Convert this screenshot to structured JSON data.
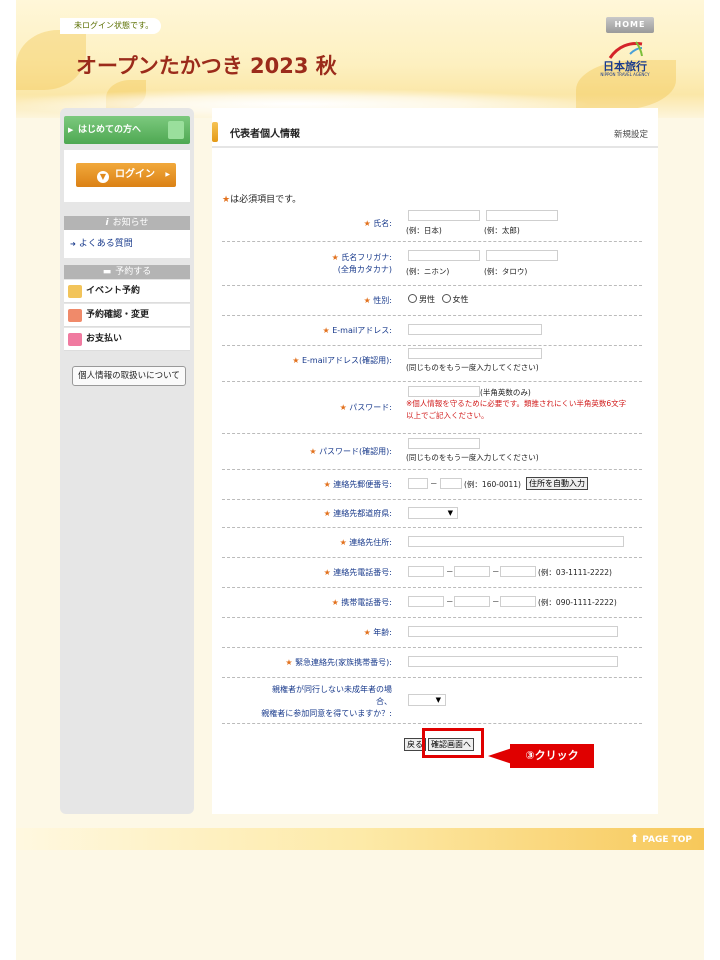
{
  "header": {
    "status": "未ログイン状態です。",
    "title": "オープンたかつき 2023 秋",
    "home_label": "HOME",
    "logo_jp": "日本旅行",
    "logo_en": "NIPPON TRAVEL AGENCY"
  },
  "sidebar": {
    "hajimete": "はじめての方へ",
    "login": "ログイン",
    "news_head": "お知らせ",
    "faq": "よくある質問",
    "reserve_head": "予約する",
    "items": [
      "イベント予約",
      "予約確認・変更",
      "お支払い"
    ],
    "privacy_btn": "個人情報の取扱いについて"
  },
  "main": {
    "title": "代表者個人情報",
    "subtitle": "新規設定",
    "required_note": "は必須項目です。",
    "fields": {
      "name_label": "氏名:",
      "name_hint1": "(例：日本)",
      "name_hint2": "(例：太郎)",
      "kana_label1": "氏名フリガナ:",
      "kana_label2": "(全角カタカナ)",
      "kana_hint1": "(例：ニホン)",
      "kana_hint2": "(例：タロウ)",
      "gender_label": "性別:",
      "gender_male": "男性",
      "gender_female": "女性",
      "email_label": "E-mailアドレス:",
      "email_confirm_label": "E-mailアドレス(確認用):",
      "email_confirm_hint": "(同じものをもう一度入力してください)",
      "password_label": "パスワード:",
      "password_hint": "(半角英数のみ)",
      "password_warn1": "※個人情報を守るために必要です。類推されにくい半角英数6文字",
      "password_warn2": "以上でご記入ください。",
      "password_confirm_label": "パスワード(確認用):",
      "password_confirm_hint": "(同じものをもう一度入力してください)",
      "zip_label": "連絡先郵便番号:",
      "zip_sep": "－",
      "zip_hint": "(例：160-0011)",
      "zip_button": "住所を自動入力",
      "pref_label": "連絡先都道府県:",
      "address_label": "連絡先住所:",
      "phone_label": "連絡先電話番号:",
      "phone_sep": "－",
      "phone_hint": "(例：03-1111-2222)",
      "mobile_label": "携帯電話番号:",
      "mobile_hint": "(例：090-1111-2222)",
      "age_label": "年齢:",
      "emergency_label": "緊急連絡先(家族携帯番号):",
      "minor_label1": "親権者が同行しない未成年者の場",
      "minor_label2": "合、",
      "minor_label3": "親権者に参加同意を得ていますか？:"
    },
    "back_button": "戻る",
    "confirm_button": "確認画面へ",
    "callout": "③クリック"
  },
  "footer": {
    "pagetop": "PAGE TOP"
  },
  "colors": {
    "title": "#9b2b1b",
    "label": "#1a3b8c",
    "accent": "#e2711d",
    "highlight": "#e00000"
  }
}
